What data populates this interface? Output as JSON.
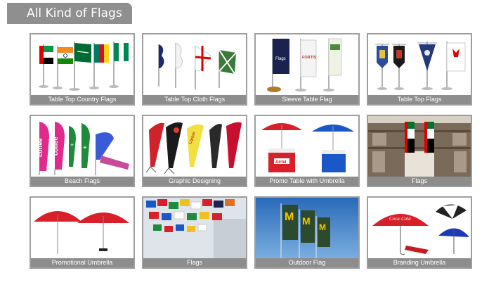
{
  "header": {
    "title": "All Kind of Flags"
  },
  "products": [
    {
      "name": "Table Top Country Flags"
    },
    {
      "name": "Table Top Cloth Flags"
    },
    {
      "name": "Sleeve Table Flag"
    },
    {
      "name": "Table Top Flags"
    },
    {
      "name": "Beach Flags"
    },
    {
      "name": "Graphic Designing"
    },
    {
      "name": "Promo Table with Umbrella"
    },
    {
      "name": "Flags"
    },
    {
      "name": "Promotional Umbrella"
    },
    {
      "name": "Flags"
    },
    {
      "name": "Outdoor Flag"
    },
    {
      "name": "Branding Umbrella"
    }
  ],
  "image_text": {
    "sleeve_flag_1": "Flags",
    "sleeve_flag_2": "FORTIS",
    "beach_flag_1": "coffee",
    "beach_flag_2": "coffee",
    "graphic_flag_1": "Lipton",
    "promo_table_brand": "Airtel",
    "umbrella_brand": "Coca-Cola"
  },
  "colors": {
    "header_bg": "#8f8f8f",
    "caption_bg": "#8d8d8d",
    "card_border": "#9e9e9e"
  }
}
